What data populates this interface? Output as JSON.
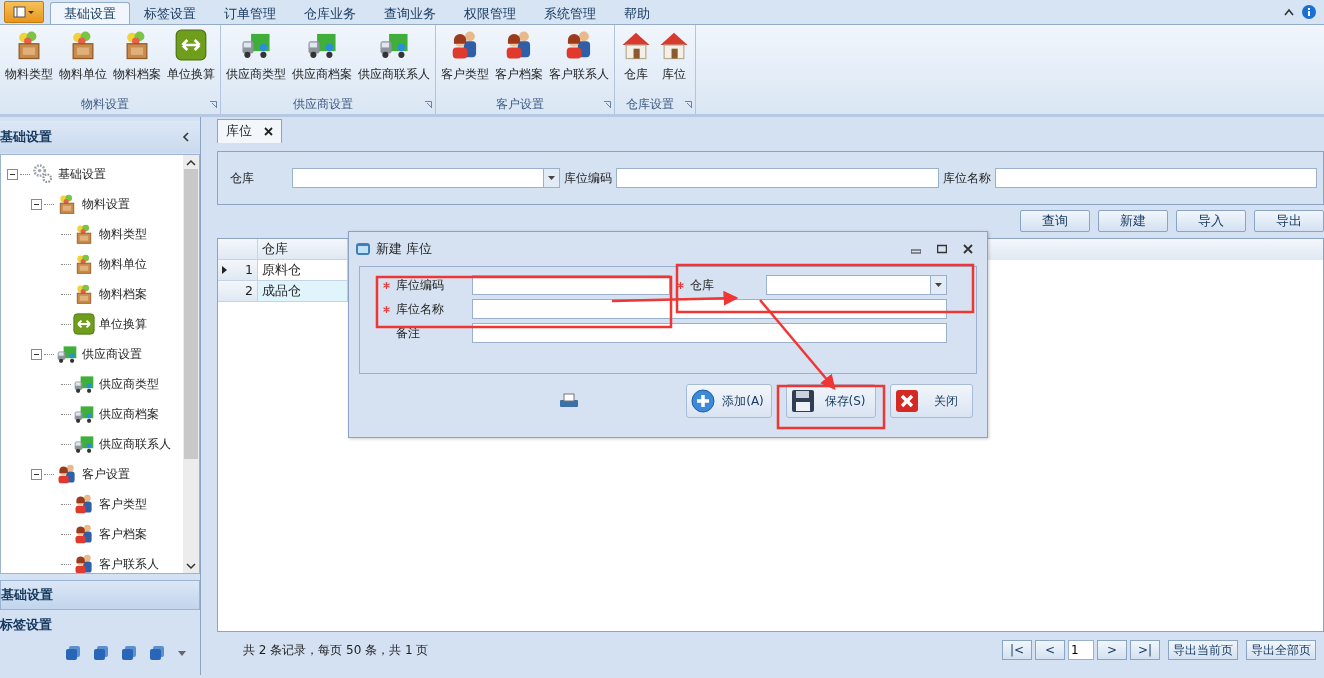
{
  "ribbon": {
    "tabs": [
      {
        "label": "基础设置",
        "selected": true
      },
      {
        "label": "标签设置",
        "selected": false
      },
      {
        "label": "订单管理",
        "selected": false
      },
      {
        "label": "仓库业务",
        "selected": false
      },
      {
        "label": "查询业务",
        "selected": false
      },
      {
        "label": "权限管理",
        "selected": false
      },
      {
        "label": "系统管理",
        "selected": false
      },
      {
        "label": "帮助",
        "selected": false
      }
    ],
    "groups": [
      {
        "title": "物料设置",
        "items": [
          {
            "label": "物料类型",
            "kind": "crate"
          },
          {
            "label": "物料单位",
            "kind": "crate"
          },
          {
            "label": "物料档案",
            "kind": "crate"
          },
          {
            "label": "单位换算",
            "kind": "swap"
          }
        ]
      },
      {
        "title": "供应商设置",
        "items": [
          {
            "label": "供应商类型",
            "kind": "truck"
          },
          {
            "label": "供应商档案",
            "kind": "truck"
          },
          {
            "label": "供应商联系人",
            "kind": "truck"
          }
        ]
      },
      {
        "title": "客户设置",
        "items": [
          {
            "label": "客户类型",
            "kind": "people"
          },
          {
            "label": "客户档案",
            "kind": "people"
          },
          {
            "label": "客户联系人",
            "kind": "people"
          }
        ]
      },
      {
        "title": "仓库设置",
        "items": [
          {
            "label": "仓库",
            "kind": "house"
          },
          {
            "label": "库位",
            "kind": "house"
          }
        ]
      }
    ]
  },
  "sidebar": {
    "title": "基础设置",
    "tree": [
      {
        "label": "基础设置",
        "kind": "gear",
        "expanded": true,
        "children": [
          {
            "label": "物料设置",
            "kind": "crate",
            "expanded": true,
            "children": [
              {
                "label": "物料类型",
                "kind": "crate"
              },
              {
                "label": "物料单位",
                "kind": "crate"
              },
              {
                "label": "物料档案",
                "kind": "crate"
              },
              {
                "label": "单位换算",
                "kind": "swap"
              }
            ]
          },
          {
            "label": "供应商设置",
            "kind": "truck",
            "expanded": true,
            "children": [
              {
                "label": "供应商类型",
                "kind": "truck"
              },
              {
                "label": "供应商档案",
                "kind": "truck"
              },
              {
                "label": "供应商联系人",
                "kind": "truck"
              }
            ]
          },
          {
            "label": "客户设置",
            "kind": "people",
            "expanded": true,
            "children": [
              {
                "label": "客户类型",
                "kind": "people"
              },
              {
                "label": "客户档案",
                "kind": "people"
              },
              {
                "label": "客户联系人",
                "kind": "people"
              }
            ]
          }
        ]
      }
    ],
    "sections": [
      {
        "label": "基础设置",
        "selected": true
      },
      {
        "label": "标签设置",
        "selected": false
      }
    ]
  },
  "doc_tabs": [
    {
      "label": "库位",
      "selected": true
    }
  ],
  "filter": {
    "fields": [
      {
        "label": "仓库",
        "kind": "dropdown"
      },
      {
        "label": "库位编码",
        "kind": "text"
      },
      {
        "label": "库位名称",
        "kind": "text"
      }
    ]
  },
  "actions": [
    "查询",
    "新建",
    "导入",
    "导出"
  ],
  "grid": {
    "columns": [
      "仓库"
    ],
    "rows": [
      {
        "number": "1",
        "cells": [
          "原料仓"
        ],
        "current": true,
        "selected": false
      },
      {
        "number": "2",
        "cells": [
          "成品仓"
        ],
        "current": false,
        "selected": true
      }
    ]
  },
  "footer": {
    "summary": "共 2 条记录，每页 50 条，共 1 页",
    "pager": [
      "|<",
      "<",
      "1",
      ">",
      ">|"
    ],
    "buttons": [
      "导出当前页",
      "导出全部页"
    ]
  },
  "dialog": {
    "title": "新建 库位",
    "fields": [
      {
        "label": "库位编码",
        "required": true,
        "kind": "text"
      },
      {
        "label": "仓库",
        "required": true,
        "kind": "dropdown"
      },
      {
        "label": "库位名称",
        "required": true,
        "kind": "text"
      },
      {
        "label": "备注",
        "required": false,
        "kind": "text"
      }
    ],
    "buttons": [
      {
        "label": "添加(A)",
        "kind": "add"
      },
      {
        "label": "保存(S)",
        "kind": "save"
      },
      {
        "label": "关闭",
        "kind": "close"
      }
    ]
  }
}
